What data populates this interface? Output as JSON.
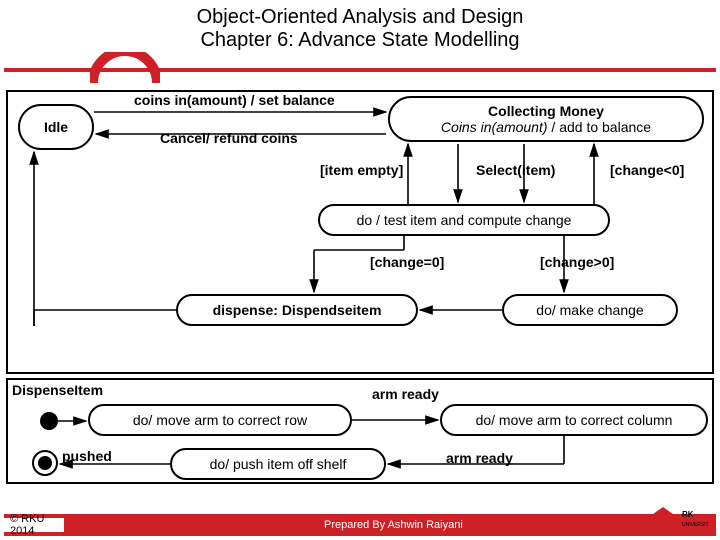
{
  "header": {
    "line1": "Object-Oriented Analysis and Design",
    "line2": "Chapter 6: Advance State Modelling"
  },
  "states": {
    "idle": "Idle",
    "collecting_title": "Collecting Money",
    "collecting_action": "Coins in(amount) / add to balance",
    "do_test": "do / test item and compute change",
    "dispense_state": "dispense: Dispendseitem",
    "make_change": "do/ make change",
    "dispense_item_label": "DispenseItem",
    "move_row": "do/ move arm to correct row",
    "move_col": "do/ move arm to correct column",
    "push_shelf": "do/ push item off shelf"
  },
  "transitions": {
    "coins_in_set": "coins in(amount) / set balance",
    "cancel_refund": "Cancel/ refund coins",
    "item_empty": "[item empty]",
    "select_item": "Select(item)",
    "change_lt0": "[change<0]",
    "change_eq0": "[change=0]",
    "change_gt0": "[change>0]",
    "arm_ready1": "arm ready",
    "arm_ready2": "arm ready",
    "pushed": "pushed"
  },
  "footer": {
    "left": "© RKU 2014",
    "right": "Prepared By Ashwin Raiyani"
  },
  "chart_data": {
    "type": "state_diagram",
    "title": "Vending Machine State Model",
    "states": [
      {
        "id": "Idle"
      },
      {
        "id": "CollectingMoney",
        "entry": "Coins in(amount) / add to balance"
      },
      {
        "id": "TestItem",
        "do": "test item and compute change"
      },
      {
        "id": "DispenseItem_composite",
        "label": "dispense: Dispendseitem"
      },
      {
        "id": "MakeChange",
        "do": "make change"
      },
      {
        "id": "MoveRow",
        "do": "move arm to correct row",
        "parent": "DispenseItem"
      },
      {
        "id": "MoveColumn",
        "do": "move arm to correct column",
        "parent": "DispenseItem"
      },
      {
        "id": "PushShelf",
        "do": "push item off shelf",
        "parent": "DispenseItem"
      }
    ],
    "transitions": [
      {
        "from": "Idle",
        "to": "CollectingMoney",
        "trigger": "coins in(amount)",
        "action": "set balance"
      },
      {
        "from": "CollectingMoney",
        "to": "Idle",
        "trigger": "Cancel",
        "action": "refund coins"
      },
      {
        "from": "CollectingMoney",
        "to": "TestItem",
        "trigger": "Select(item)"
      },
      {
        "from": "TestItem",
        "to": "CollectingMoney",
        "guard": "item empty"
      },
      {
        "from": "TestItem",
        "to": "CollectingMoney",
        "guard": "change<0"
      },
      {
        "from": "TestItem",
        "to": "DispenseItem_composite",
        "guard": "change=0"
      },
      {
        "from": "TestItem",
        "to": "MakeChange",
        "guard": "change>0"
      },
      {
        "from": "MakeChange",
        "to": "DispenseItem_composite"
      },
      {
        "from": "DispenseItem_composite",
        "to": "Idle"
      },
      {
        "from": "MoveRow",
        "to": "MoveColumn",
        "trigger": "arm ready"
      },
      {
        "from": "MoveColumn",
        "to": "PushShelf",
        "trigger": "arm ready"
      },
      {
        "from": "PushShelf",
        "to": "final",
        "trigger": "pushed"
      }
    ]
  }
}
